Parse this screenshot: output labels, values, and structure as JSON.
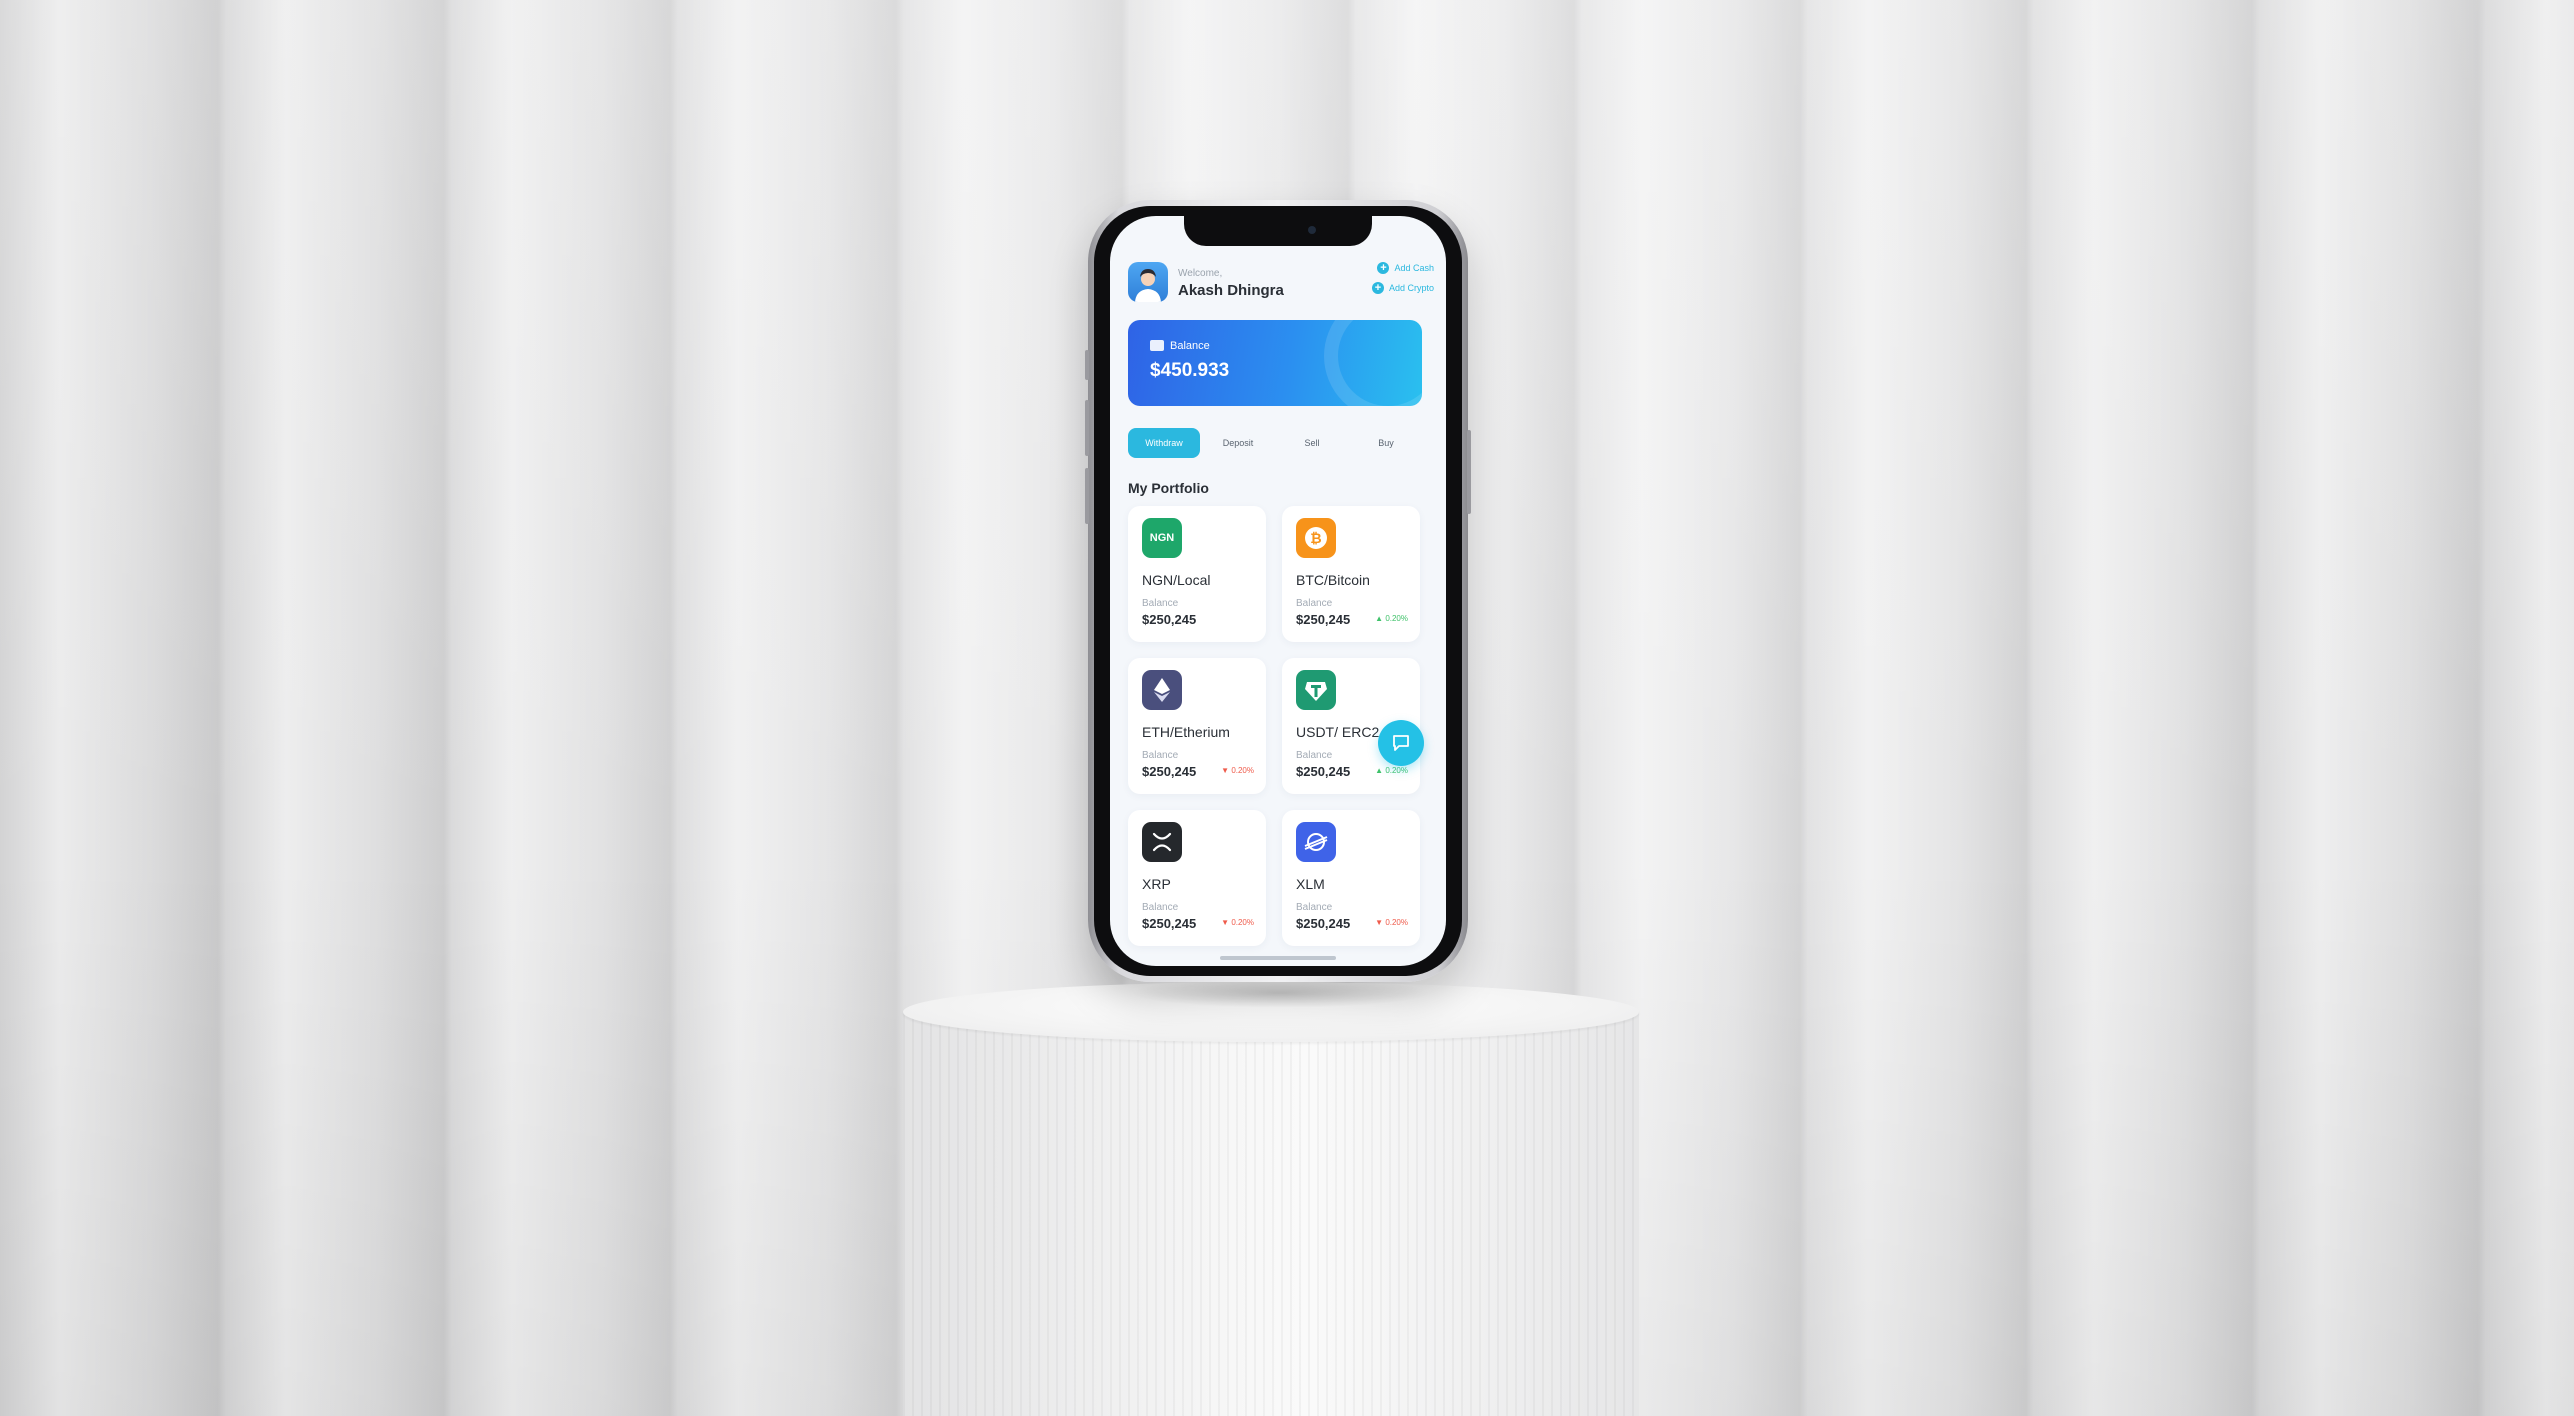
{
  "header": {
    "welcome": "Welcome,",
    "user_name": "Akash Dhingra",
    "add_cash": "Add Cash",
    "add_crypto": "Add Crypto"
  },
  "balance": {
    "label": "Balance",
    "value": "$450.933"
  },
  "actions": [
    "Withdraw",
    "Deposit",
    "Sell",
    "Buy"
  ],
  "active_action": "Withdraw",
  "portfolio": {
    "title": "My Portfolio",
    "items": [
      {
        "name": "NGN/Local",
        "icon": "ngn-icon",
        "icon_text": "NGN",
        "balance_label": "Balance",
        "balance": "$250,245",
        "change": "",
        "trend": "none",
        "color": "#1ea76a"
      },
      {
        "name": "BTC/Bitcoin",
        "icon": "bitcoin-icon",
        "icon_text": "₿",
        "balance_label": "Balance",
        "balance": "$250,245",
        "change": "▲ 0.20%",
        "trend": "up",
        "color": "#f7931a"
      },
      {
        "name": "ETH/Etherium",
        "icon": "ethereum-icon",
        "icon_text": "",
        "balance_label": "Balance",
        "balance": "$250,245",
        "change": "▼ 0.20%",
        "trend": "down",
        "color": "#4a4f7d"
      },
      {
        "name": "USDT/ ERC2",
        "icon": "tether-icon",
        "icon_text": "",
        "balance_label": "Balance",
        "balance": "$250,245",
        "change": "▲ 0.20%",
        "trend": "up",
        "color": "#1f9a72"
      },
      {
        "name": "XRP",
        "icon": "xrp-icon",
        "icon_text": "",
        "balance_label": "Balance",
        "balance": "$250,245",
        "change": "▼ 0.20%",
        "trend": "down",
        "color": "#25282c"
      },
      {
        "name": "XLM",
        "icon": "stellar-icon",
        "icon_text": "",
        "balance_label": "Balance",
        "balance": "$250,245",
        "change": "▼ 0.20%",
        "trend": "down",
        "color": "#3f63e8"
      }
    ]
  },
  "colors": {
    "accent": "#2bb8df",
    "up": "#3fc26a",
    "down": "#ef5b4b"
  }
}
